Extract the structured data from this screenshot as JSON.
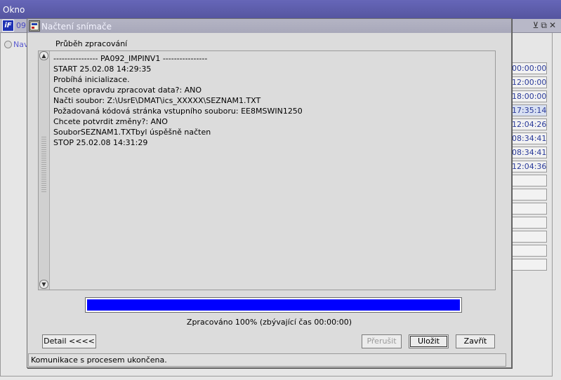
{
  "outer_window": {
    "title": "Okno"
  },
  "background_form": {
    "number": "09",
    "nav_label": "Nav",
    "times": [
      "00:00:00",
      "12:00:00",
      "18:00:00",
      "17:35:14",
      "12:04:26",
      "08:34:41",
      "08:34:41",
      "12:04:36",
      "",
      "",
      "",
      "",
      "",
      "",
      ""
    ],
    "selected_time_index": 3
  },
  "dialog": {
    "title": "Načtení snímače",
    "group_label": "Průběh zpracování",
    "log": [
      "---------------- PA092_IMPINV1 ----------------",
      "START 25.02.08 14:29:35",
      "Probíhá inicializace.",
      "Chcete opravdu zpracovat data?: ANO",
      "Načti soubor: Z:\\UsrE\\DMAT\\ics_XXXXX\\SEZNAM1.TXT",
      "Požadovaná kódová stránka vstupního souboru: EE8MSWIN1250",
      "Chcete potvrdit změny?: ANO",
      "SouborSEZNAM1.TXTbyl úspěšně načten",
      "STOP 25.02.08 14:31:29"
    ],
    "progress": {
      "percent": 100
    },
    "progress_text": "Zpracováno 100% (zbývající čas 00:00:00)",
    "buttons": {
      "detail": "Detail  <<<<",
      "prerusit": "Přerušit",
      "ulozit": "Uložit",
      "zavrit": "Zavřít"
    },
    "status": "Komunikace s procesem ukončena."
  },
  "icons": [
    "app-logo-icon",
    "dialog-app-icon",
    "minimize-icon",
    "restore-icon",
    "close-icon",
    "scroll-up-icon",
    "scroll-down-icon"
  ],
  "colors": {
    "outer_titlebar": "#5a5aa8",
    "progress_fill": "#0000ff",
    "time_text": "#2a3a9a"
  }
}
